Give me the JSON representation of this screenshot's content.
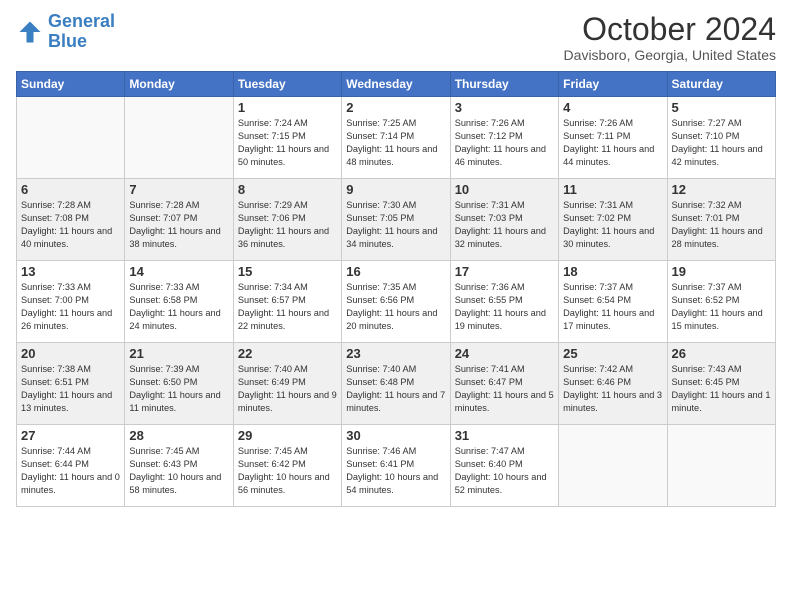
{
  "logo": {
    "line1": "General",
    "line2": "Blue"
  },
  "title": "October 2024",
  "subtitle": "Davisboro, Georgia, United States",
  "days_of_week": [
    "Sunday",
    "Monday",
    "Tuesday",
    "Wednesday",
    "Thursday",
    "Friday",
    "Saturday"
  ],
  "weeks": [
    [
      {
        "day": "",
        "info": ""
      },
      {
        "day": "",
        "info": ""
      },
      {
        "day": "1",
        "info": "Sunrise: 7:24 AM\nSunset: 7:15 PM\nDaylight: 11 hours and 50 minutes."
      },
      {
        "day": "2",
        "info": "Sunrise: 7:25 AM\nSunset: 7:14 PM\nDaylight: 11 hours and 48 minutes."
      },
      {
        "day": "3",
        "info": "Sunrise: 7:26 AM\nSunset: 7:12 PM\nDaylight: 11 hours and 46 minutes."
      },
      {
        "day": "4",
        "info": "Sunrise: 7:26 AM\nSunset: 7:11 PM\nDaylight: 11 hours and 44 minutes."
      },
      {
        "day": "5",
        "info": "Sunrise: 7:27 AM\nSunset: 7:10 PM\nDaylight: 11 hours and 42 minutes."
      }
    ],
    [
      {
        "day": "6",
        "info": "Sunrise: 7:28 AM\nSunset: 7:08 PM\nDaylight: 11 hours and 40 minutes."
      },
      {
        "day": "7",
        "info": "Sunrise: 7:28 AM\nSunset: 7:07 PM\nDaylight: 11 hours and 38 minutes."
      },
      {
        "day": "8",
        "info": "Sunrise: 7:29 AM\nSunset: 7:06 PM\nDaylight: 11 hours and 36 minutes."
      },
      {
        "day": "9",
        "info": "Sunrise: 7:30 AM\nSunset: 7:05 PM\nDaylight: 11 hours and 34 minutes."
      },
      {
        "day": "10",
        "info": "Sunrise: 7:31 AM\nSunset: 7:03 PM\nDaylight: 11 hours and 32 minutes."
      },
      {
        "day": "11",
        "info": "Sunrise: 7:31 AM\nSunset: 7:02 PM\nDaylight: 11 hours and 30 minutes."
      },
      {
        "day": "12",
        "info": "Sunrise: 7:32 AM\nSunset: 7:01 PM\nDaylight: 11 hours and 28 minutes."
      }
    ],
    [
      {
        "day": "13",
        "info": "Sunrise: 7:33 AM\nSunset: 7:00 PM\nDaylight: 11 hours and 26 minutes."
      },
      {
        "day": "14",
        "info": "Sunrise: 7:33 AM\nSunset: 6:58 PM\nDaylight: 11 hours and 24 minutes."
      },
      {
        "day": "15",
        "info": "Sunrise: 7:34 AM\nSunset: 6:57 PM\nDaylight: 11 hours and 22 minutes."
      },
      {
        "day": "16",
        "info": "Sunrise: 7:35 AM\nSunset: 6:56 PM\nDaylight: 11 hours and 20 minutes."
      },
      {
        "day": "17",
        "info": "Sunrise: 7:36 AM\nSunset: 6:55 PM\nDaylight: 11 hours and 19 minutes."
      },
      {
        "day": "18",
        "info": "Sunrise: 7:37 AM\nSunset: 6:54 PM\nDaylight: 11 hours and 17 minutes."
      },
      {
        "day": "19",
        "info": "Sunrise: 7:37 AM\nSunset: 6:52 PM\nDaylight: 11 hours and 15 minutes."
      }
    ],
    [
      {
        "day": "20",
        "info": "Sunrise: 7:38 AM\nSunset: 6:51 PM\nDaylight: 11 hours and 13 minutes."
      },
      {
        "day": "21",
        "info": "Sunrise: 7:39 AM\nSunset: 6:50 PM\nDaylight: 11 hours and 11 minutes."
      },
      {
        "day": "22",
        "info": "Sunrise: 7:40 AM\nSunset: 6:49 PM\nDaylight: 11 hours and 9 minutes."
      },
      {
        "day": "23",
        "info": "Sunrise: 7:40 AM\nSunset: 6:48 PM\nDaylight: 11 hours and 7 minutes."
      },
      {
        "day": "24",
        "info": "Sunrise: 7:41 AM\nSunset: 6:47 PM\nDaylight: 11 hours and 5 minutes."
      },
      {
        "day": "25",
        "info": "Sunrise: 7:42 AM\nSunset: 6:46 PM\nDaylight: 11 hours and 3 minutes."
      },
      {
        "day": "26",
        "info": "Sunrise: 7:43 AM\nSunset: 6:45 PM\nDaylight: 11 hours and 1 minute."
      }
    ],
    [
      {
        "day": "27",
        "info": "Sunrise: 7:44 AM\nSunset: 6:44 PM\nDaylight: 11 hours and 0 minutes."
      },
      {
        "day": "28",
        "info": "Sunrise: 7:45 AM\nSunset: 6:43 PM\nDaylight: 10 hours and 58 minutes."
      },
      {
        "day": "29",
        "info": "Sunrise: 7:45 AM\nSunset: 6:42 PM\nDaylight: 10 hours and 56 minutes."
      },
      {
        "day": "30",
        "info": "Sunrise: 7:46 AM\nSunset: 6:41 PM\nDaylight: 10 hours and 54 minutes."
      },
      {
        "day": "31",
        "info": "Sunrise: 7:47 AM\nSunset: 6:40 PM\nDaylight: 10 hours and 52 minutes."
      },
      {
        "day": "",
        "info": ""
      },
      {
        "day": "",
        "info": ""
      }
    ]
  ]
}
